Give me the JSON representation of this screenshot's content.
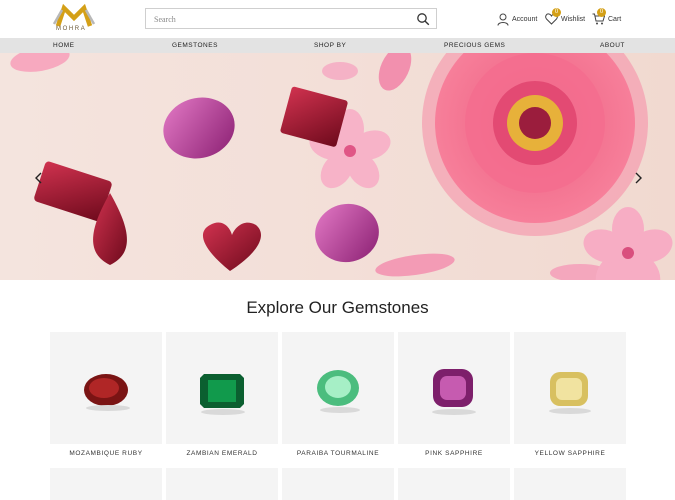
{
  "brand": {
    "name": "MOHRA"
  },
  "search": {
    "placeholder": "Search"
  },
  "header": {
    "account_label": "Account",
    "wishlist_label": "Wishlist",
    "wishlist_count": "0",
    "cart_label": "Cart",
    "cart_count": "0"
  },
  "nav": {
    "items": [
      {
        "label": "HOME"
      },
      {
        "label": "GEMSTONES"
      },
      {
        "label": "SHOP BY"
      },
      {
        "label": "PRECIOUS GEMS"
      },
      {
        "label": "ABOUT"
      }
    ]
  },
  "section": {
    "title": "Explore Our Gemstones"
  },
  "gemstones": [
    {
      "name": "MOZAMBIQUE RUBY",
      "color": "#8e1a1a"
    },
    {
      "name": "ZAMBIAN EMERALD",
      "color": "#0f7a3e"
    },
    {
      "name": "PARAIBA TOURMALINE",
      "color": "#6ed39a"
    },
    {
      "name": "PINK SAPPHIRE",
      "color": "#a4348f"
    },
    {
      "name": "YELLOW SAPPHIRE",
      "color": "#e6d27a"
    }
  ],
  "colors": {
    "brand_gold": "#d4a017",
    "nav_bg": "#e3e3e3",
    "hero_bg": "#f3dfd8",
    "card_bg": "#f4f4f4"
  },
  "icons": [
    "search-icon",
    "account-icon",
    "wishlist-icon",
    "cart-icon",
    "chevron-left-icon",
    "chevron-right-icon"
  ]
}
